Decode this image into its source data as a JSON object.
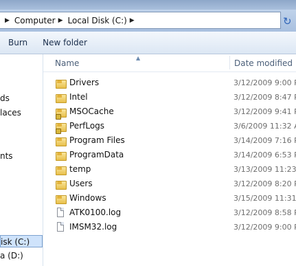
{
  "breadcrumb": [
    "Computer",
    "Local Disk (C:)"
  ],
  "toolbar": {
    "burn": "Burn",
    "new_folder": "New folder"
  },
  "nav": {
    "items": [
      "ds",
      "laces",
      "nts",
      "isk (C:)",
      "a (D:)"
    ]
  },
  "columns": {
    "name": "Name",
    "date": "Date modified"
  },
  "files": [
    {
      "name": "Drivers",
      "date": "3/12/2009 9:00 P",
      "type": "folder"
    },
    {
      "name": "Intel",
      "date": "3/12/2009 8:47 P",
      "type": "folder"
    },
    {
      "name": "MSOCache",
      "date": "3/12/2009 9:41 P",
      "type": "locked-folder"
    },
    {
      "name": "PerfLogs",
      "date": "3/6/2009 11:32 A",
      "type": "locked-folder"
    },
    {
      "name": "Program Files",
      "date": "3/14/2009 7:16 P",
      "type": "folder"
    },
    {
      "name": "ProgramData",
      "date": "3/14/2009 6:53 P",
      "type": "folder"
    },
    {
      "name": "temp",
      "date": "3/13/2009 11:23 P",
      "type": "folder"
    },
    {
      "name": "Users",
      "date": "3/12/2009 8:20 P",
      "type": "folder"
    },
    {
      "name": "Windows",
      "date": "3/15/2009 11:31 P",
      "type": "folder"
    },
    {
      "name": "ATK0100.log",
      "date": "3/12/2009 8:58 P",
      "type": "file"
    },
    {
      "name": "IMSM32.log",
      "date": "3/12/2009 9:00 P",
      "type": "file"
    }
  ]
}
